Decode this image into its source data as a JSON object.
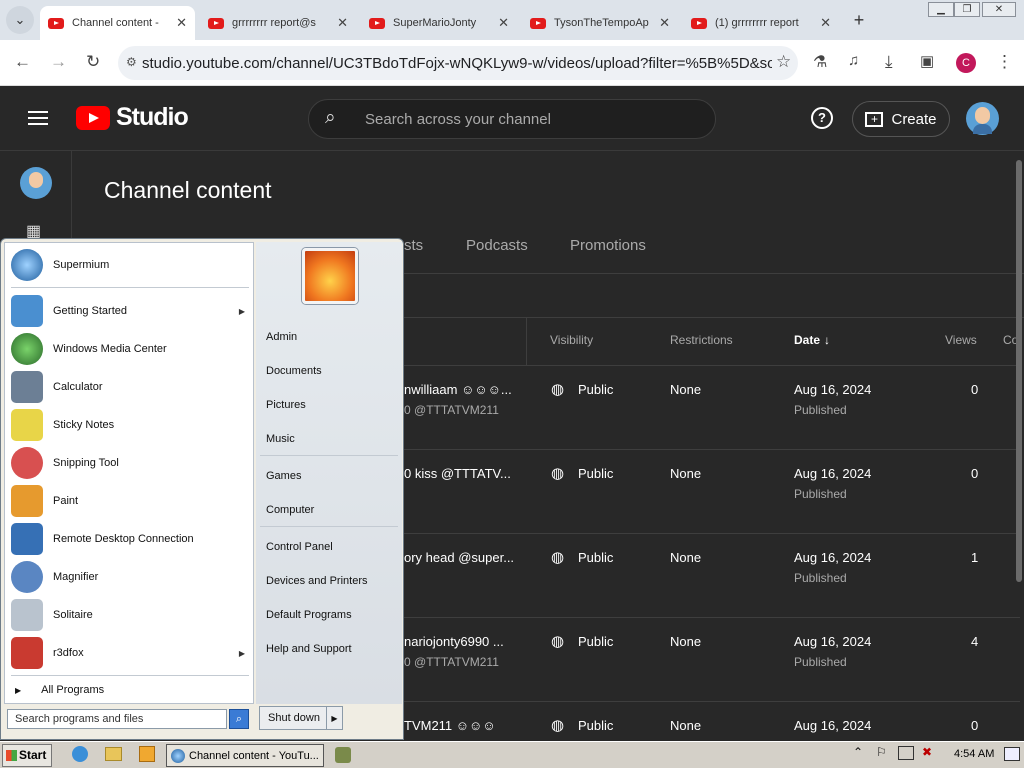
{
  "browser": {
    "tabs": [
      {
        "title": "Channel content -",
        "active": true
      },
      {
        "title": "grrrrrrrr report@s",
        "active": false
      },
      {
        "title": "SuperMarioJonty",
        "active": false
      },
      {
        "title": "TysonTheTempoAp",
        "active": false
      },
      {
        "title": "(1) grrrrrrrr report",
        "active": false
      }
    ],
    "new_tab_symbol": "+",
    "url": "studio.youtube.com/channel/UC3TBdoTdFojx-wNQKLyw9-w/videos/upload?filter=%5B%5D&sort=...",
    "profile_initial": "C"
  },
  "studio": {
    "logo_text": "Studio",
    "search_placeholder": "Search across your channel",
    "create_label": "Create",
    "page_title": "Channel content",
    "tabs": [
      "sts",
      "Podcasts",
      "Promotions"
    ],
    "columns": {
      "visibility": "Visibility",
      "restrictions": "Restrictions",
      "date": "Date",
      "views": "Views",
      "comments": "Co"
    },
    "rows": [
      {
        "title": "nwilliaam ☺☺☺...",
        "subtitle": "0 @TTTATVM211",
        "visibility": "Public",
        "restrictions": "None",
        "date": "Aug 16, 2024",
        "status": "Published",
        "views": "0"
      },
      {
        "title": "0 kiss @TTTATV...",
        "subtitle": "",
        "visibility": "Public",
        "restrictions": "None",
        "date": "Aug 16, 2024",
        "status": "Published",
        "views": "0"
      },
      {
        "title": "ory head @super...",
        "subtitle": "",
        "visibility": "Public",
        "restrictions": "None",
        "date": "Aug 16, 2024",
        "status": "Published",
        "views": "1"
      },
      {
        "title": "nariojonty6990 ...",
        "subtitle": "0 @TTTATVM211",
        "visibility": "Public",
        "restrictions": "None",
        "date": "Aug 16, 2024",
        "status": "Published",
        "views": "4"
      },
      {
        "title": "TVM211 ☺☺☺",
        "subtitle": "",
        "visibility": "Public",
        "restrictions": "None",
        "date": "Aug 16, 2024",
        "status": "",
        "views": "0"
      }
    ]
  },
  "start_menu": {
    "pinned": [
      {
        "label": "Supermium",
        "color": "#3b7fbf"
      }
    ],
    "programs": [
      {
        "label": "Getting Started",
        "color": "#4a8fd0",
        "submenu": true
      },
      {
        "label": "Windows Media Center",
        "color": "#3e9a3e",
        "submenu": false
      },
      {
        "label": "Calculator",
        "color": "#6c7f95",
        "submenu": false
      },
      {
        "label": "Sticky Notes",
        "color": "#e8d548",
        "submenu": false
      },
      {
        "label": "Snipping Tool",
        "color": "#d85050",
        "submenu": false
      },
      {
        "label": "Paint",
        "color": "#e69a2e",
        "submenu": false
      },
      {
        "label": "Remote Desktop Connection",
        "color": "#3670b5",
        "submenu": false
      },
      {
        "label": "Magnifier",
        "color": "#5a86c2",
        "submenu": false
      },
      {
        "label": "Solitaire",
        "color": "#b9c3ce",
        "submenu": false
      },
      {
        "label": "r3dfox",
        "color": "#c93a30",
        "submenu": true
      }
    ],
    "all_programs": "All Programs",
    "right_items": [
      "Admin",
      "Documents",
      "Pictures",
      "Music",
      "Games",
      "Computer",
      "Control Panel",
      "Devices and Printers",
      "Default Programs",
      "Help and Support"
    ],
    "search_placeholder": "Search programs and files",
    "shutdown_label": "Shut down"
  },
  "taskbar": {
    "start_label": "Start",
    "task_label": "Channel content - YouTu...",
    "clock": "4:54 AM"
  }
}
